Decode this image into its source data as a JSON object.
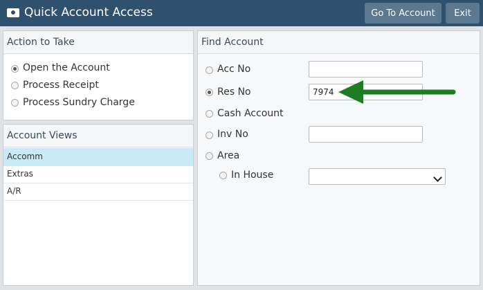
{
  "window": {
    "title": "Quick Account Access",
    "icon": "cash-icon",
    "go_to_account_label": "Go To Account",
    "exit_label": "Exit"
  },
  "action_panel": {
    "heading": "Action to Take",
    "options": [
      {
        "label": "Open the Account",
        "selected": true
      },
      {
        "label": "Process Receipt",
        "selected": false
      },
      {
        "label": "Process Sundry Charge",
        "selected": false
      }
    ]
  },
  "views_panel": {
    "heading": "Account Views",
    "items": [
      {
        "label": "Accomm",
        "selected": true
      },
      {
        "label": "Extras",
        "selected": false
      },
      {
        "label": "A/R",
        "selected": false
      }
    ]
  },
  "find_panel": {
    "heading": "Find Account",
    "acc_no": {
      "label": "Acc No",
      "value": "",
      "selected": false
    },
    "res_no": {
      "label": "Res No",
      "value": "7974",
      "selected": true
    },
    "cash_account": {
      "label": "Cash Account",
      "selected": false
    },
    "inv_no": {
      "label": "Inv No",
      "value": "",
      "selected": false
    },
    "area": {
      "label": "Area",
      "selected": false
    },
    "in_house": {
      "label": "In House",
      "value": "",
      "selected": false
    }
  },
  "annotation": {
    "arrow_color": "#1e7d22"
  }
}
